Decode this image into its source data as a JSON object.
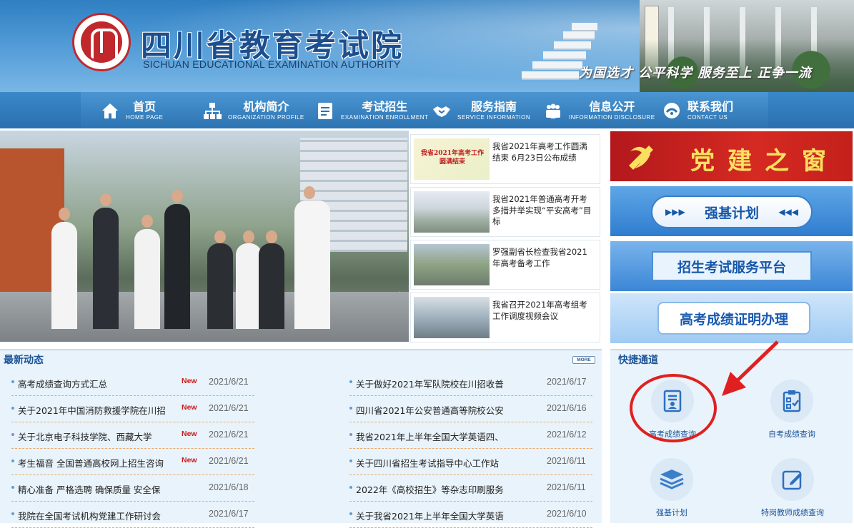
{
  "header": {
    "title": "四川省教育考试院",
    "subtitle": "SICHUAN EDUCATIONAL EXAMINATION AUTHORITY",
    "slogan": "为国选才 公平科学 服务至上 正争一流"
  },
  "nav": [
    {
      "cn": "首页",
      "en": "HOME PAGE",
      "icon": "home-icon"
    },
    {
      "cn": "机构简介",
      "en": "ORGANIZATION PROFILE",
      "icon": "org-chart-icon"
    },
    {
      "cn": "考试招生",
      "en": "EXAMINATION ENROLLMENT",
      "icon": "document-icon"
    },
    {
      "cn": "服务指南",
      "en": "SERVICE INFORMATION",
      "icon": "handshake-icon"
    },
    {
      "cn": "信息公开",
      "en": "INFORMATION DISCLOSURE",
      "icon": "people-icon"
    },
    {
      "cn": "联系我们",
      "en": "CONTACT US",
      "icon": "contact-icon"
    }
  ],
  "featured": [
    {
      "caption": "我省2021年高考工作圆满结束 6月23日公布成绩",
      "pic_text": "我省2021年高考工作圆满结束"
    },
    {
      "caption": "我省2021年普通高考开考 多措并举实现“平安高考”目标"
    },
    {
      "caption": "罗强副省长检查我省2021年高考备考工作"
    },
    {
      "caption": "我省召开2021年高考组考工作调度视频会议"
    }
  ],
  "banners": {
    "party": "党建之窗",
    "qiangji": "强基计划",
    "platform": "招生考试服务平台",
    "certificate": "高考成绩证明办理"
  },
  "latest": {
    "title": "最新动态",
    "more": "MORE",
    "left": [
      {
        "title": "高考成绩查询方式汇总",
        "badge": "New",
        "date": "2021/6/21"
      },
      {
        "title": "关于2021年中国消防救援学院在川招",
        "badge": "New",
        "date": "2021/6/21"
      },
      {
        "title": "关于北京电子科技学院、西藏大学",
        "badge": "New",
        "date": "2021/6/21"
      },
      {
        "title": "考生福音 全国普通高校网上招生咨询",
        "badge": "New",
        "date": "2021/6/21"
      },
      {
        "title": "精心准备 严格选聘 确保质量 安全保",
        "badge": "",
        "date": "2021/6/18"
      },
      {
        "title": "我院在全国考试机构党建工作研讨会",
        "badge": "",
        "date": "2021/6/17"
      }
    ],
    "right": [
      {
        "title": "关于做好2021年军队院校在川招收普",
        "date": "2021/6/17"
      },
      {
        "title": "四川省2021年公安普通高等院校公安",
        "date": "2021/6/16"
      },
      {
        "title": "我省2021年上半年全国大学英语四、",
        "date": "2021/6/12"
      },
      {
        "title": "关于四川省招生考试指导中心工作站",
        "date": "2021/6/11"
      },
      {
        "title": "2022年《高校招生》等杂志印刷服务",
        "date": "2021/6/11"
      },
      {
        "title": "关于我省2021年上半年全国大学英语",
        "date": "2021/6/10"
      }
    ]
  },
  "quick": {
    "title": "快捷通道",
    "items": [
      {
        "label": "高考成绩查询",
        "icon": "score-report-icon"
      },
      {
        "label": "自考成绩查询",
        "icon": "clipboard-check-icon"
      },
      {
        "label": "强基计划",
        "icon": "layers-icon"
      },
      {
        "label": "特岗教师成绩查询",
        "icon": "edit-icon"
      }
    ]
  },
  "colors": {
    "accent": "#1d5598",
    "nav": "#2c73b2",
    "badge": "#c81b1b",
    "annotation": "#e02020"
  }
}
